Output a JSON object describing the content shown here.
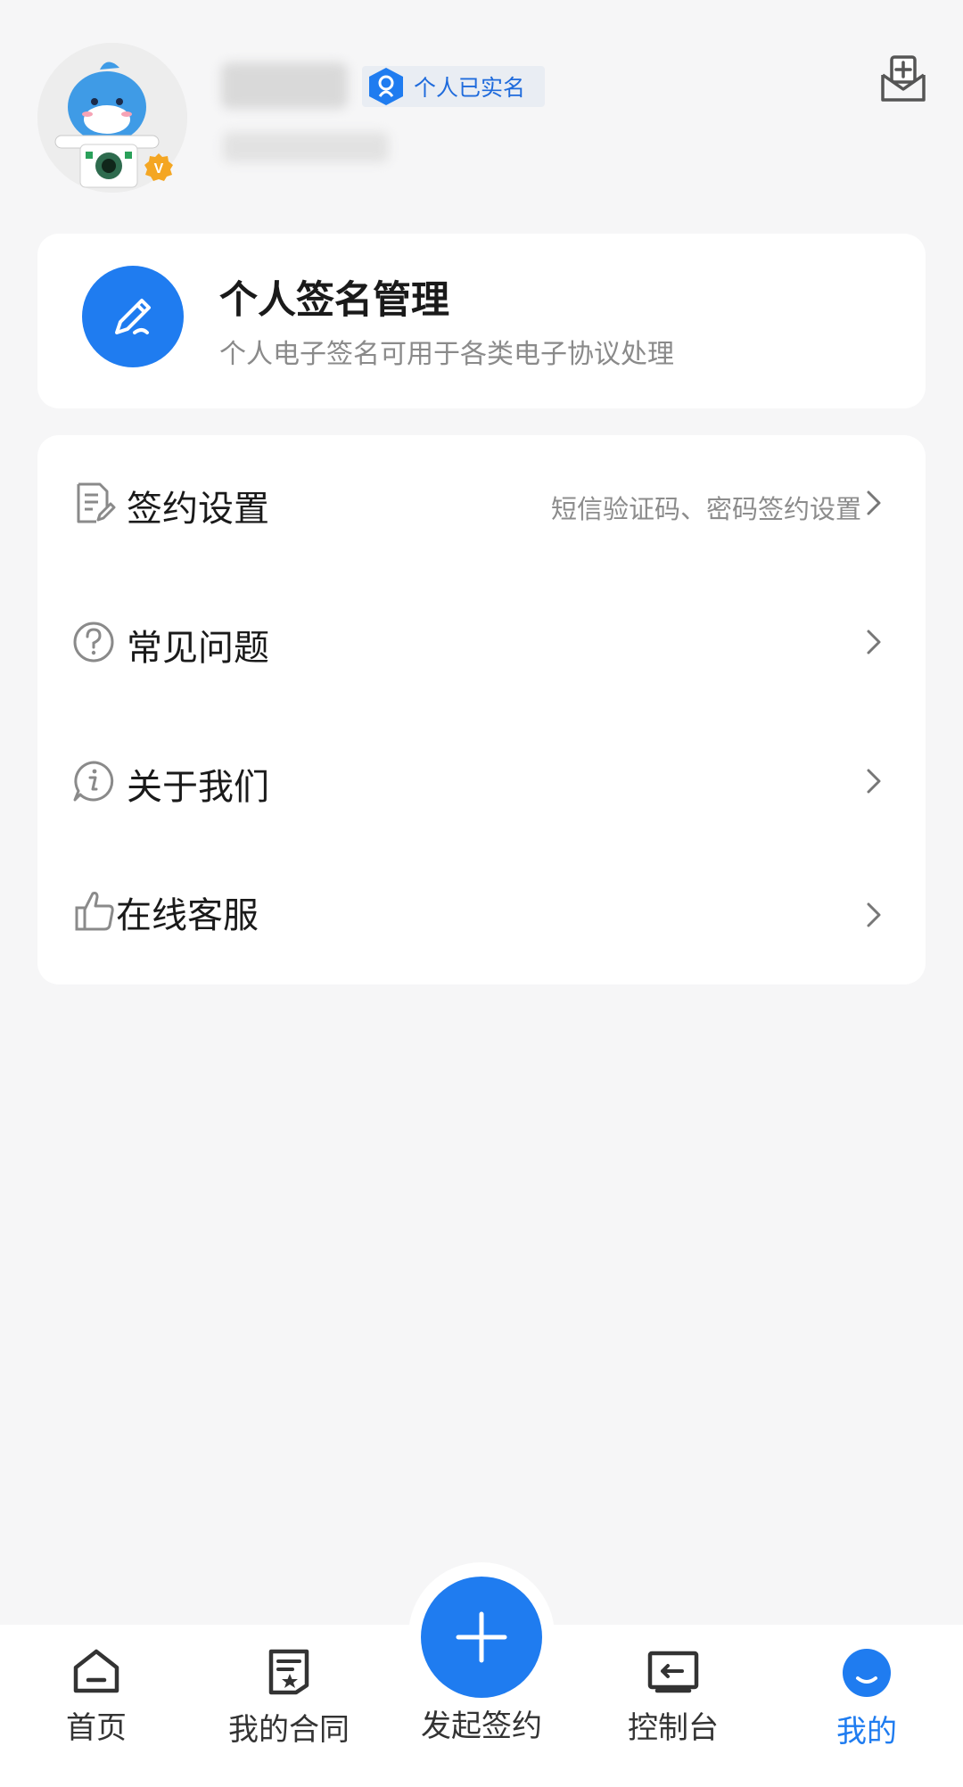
{
  "header": {
    "verified_label": "个人已实名",
    "avatar_badge": "V"
  },
  "signature_card": {
    "title": "个人签名管理",
    "subtitle": "个人电子签名可用于各类电子协议处理"
  },
  "menu": {
    "items": [
      {
        "label": "签约设置",
        "hint": "短信验证码、密码签约设置",
        "icon": "document-edit-icon"
      },
      {
        "label": "常见问题",
        "hint": "",
        "icon": "question-circle-icon"
      },
      {
        "label": "关于我们",
        "hint": "",
        "icon": "info-circle-icon"
      },
      {
        "label": "在线客服",
        "hint": "",
        "icon": "thumbs-up-icon"
      }
    ]
  },
  "bottom_nav": {
    "items": [
      {
        "label": "首页",
        "icon": "home-icon"
      },
      {
        "label": "我的合同",
        "icon": "contract-icon"
      },
      {
        "label": "发起签约",
        "icon": "plus-icon"
      },
      {
        "label": "控制台",
        "icon": "console-icon"
      },
      {
        "label": "我的",
        "icon": "profile-icon",
        "active": true
      }
    ]
  },
  "colors": {
    "accent": "#1f7cf0",
    "background": "#f6f6f7",
    "hint_text": "#8c8c8c"
  }
}
